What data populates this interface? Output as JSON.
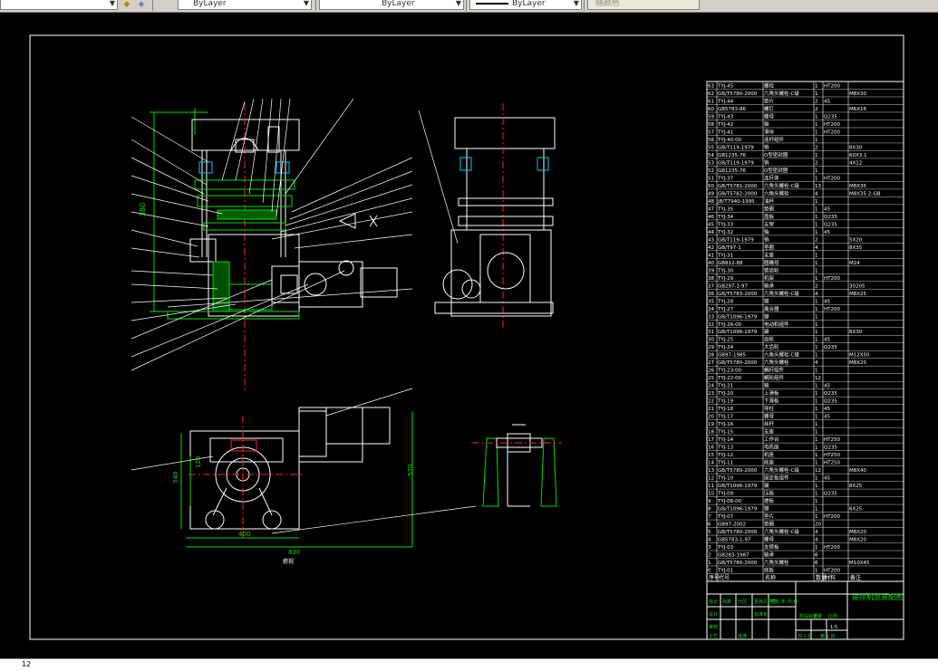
{
  "toolbar": {
    "layer_icon": "layer-stack-icon",
    "color_select": "ByLayer",
    "linetype_select": "ByLayer",
    "lineweight_select": "ByLayer",
    "plotstyle_select": "随颜色"
  },
  "drawing": {
    "title_block_name": "搓丝机总装配图",
    "bottom_label": "俯视"
  },
  "dimensions": {
    "height_left": "380",
    "width_base": "400",
    "width_total": "830",
    "plan_height": "340",
    "plan_depth": "120",
    "overall_height": "570"
  },
  "bom_header": [
    "序号",
    "代号",
    "名称",
    "数量",
    "材料",
    "备注"
  ],
  "bom_rows": [
    [
      "63",
      "TYJ-45",
      "螺栓",
      "1",
      "HT200",
      ""
    ],
    [
      "62",
      "GB/T5780-2000",
      "六角头螺栓-C级",
      "1",
      "",
      "M8X30"
    ],
    [
      "61",
      "TYJ-44",
      "垫片",
      "2",
      "45",
      ""
    ],
    [
      "60",
      "GB5783-86",
      "螺钉",
      "2",
      "",
      "M6X16"
    ],
    [
      "59",
      "TYJ-43",
      "螺母",
      "1",
      "Q235",
      ""
    ],
    [
      "58",
      "TYJ-42",
      "轴",
      "1",
      "HT200",
      ""
    ],
    [
      "57",
      "TYJ-41",
      "滑块",
      "1",
      "HT200",
      ""
    ],
    [
      "56",
      "TYJ-40-00",
      "连杆组件",
      "1",
      "",
      ""
    ],
    [
      "55",
      "GB/T119-1979",
      "销",
      "2",
      "",
      "8X30"
    ],
    [
      "54",
      "GB1235-76",
      "O型密封圈",
      "1",
      "",
      "60X3.1"
    ],
    [
      "53",
      "GB/T119-1979",
      "销",
      "2",
      "",
      "4X12"
    ],
    [
      "52",
      "GB1235-76",
      "O型密封圈",
      "1",
      "",
      ""
    ],
    [
      "51",
      "TYJ-37",
      "连杆体",
      "1",
      "HT200",
      ""
    ],
    [
      "50",
      "GB/T5781-2000",
      "六角头螺栓-C级",
      "13",
      "",
      "M8X35"
    ],
    [
      "49",
      "GB/T5782-2000",
      "六角头螺栓",
      "4",
      "",
      "M8X35 2-GB"
    ],
    [
      "48",
      "JB/T7940-1995",
      "油杯",
      "1",
      "",
      ""
    ],
    [
      "47",
      "TYJ-35",
      "垫圈",
      "1",
      "45",
      ""
    ],
    [
      "46",
      "TYJ-34",
      "盖板",
      "1",
      "Q235",
      ""
    ],
    [
      "45",
      "TYJ-33",
      "支架",
      "1",
      "Q235",
      ""
    ],
    [
      "44",
      "TYJ-32",
      "轴",
      "1",
      "45",
      ""
    ],
    [
      "43",
      "GB/T119-1979",
      "销",
      "2",
      "",
      "5X20"
    ],
    [
      "42",
      "GB/T97-1",
      "垫圈",
      "4",
      "",
      "8X35"
    ],
    [
      "41",
      "TYJ-31",
      "支座",
      "1",
      "",
      ""
    ],
    [
      "40",
      "GB812-88",
      "圆螺母",
      "1",
      "",
      "M24"
    ],
    [
      "39",
      "TYJ-30",
      "锥齿轮",
      "1",
      "",
      ""
    ],
    [
      "38",
      "TYJ-29",
      "机架",
      "1",
      "HT200",
      ""
    ],
    [
      "37",
      "GB297-1-97",
      "轴承",
      "2",
      "",
      "30205"
    ],
    [
      "36",
      "GB/T5783-2000",
      "六角头螺栓-C级",
      "4",
      "",
      "M8X25"
    ],
    [
      "35",
      "TYJ-28",
      "键",
      "1",
      "45",
      ""
    ],
    [
      "34",
      "TYJ-27",
      "离合器",
      "1",
      "HT200",
      ""
    ],
    [
      "33",
      "GB/T1096-1979",
      "键",
      "1",
      "",
      ""
    ],
    [
      "32",
      "TYJ-26-00",
      "电动机组件",
      "1",
      "",
      ""
    ],
    [
      "31",
      "GB/T1096-1979",
      "键",
      "1",
      "",
      "8X30"
    ],
    [
      "30",
      "TYJ-25",
      "齿轮",
      "1",
      "45",
      ""
    ],
    [
      "29",
      "TYJ-24",
      "大齿轮",
      "1",
      "Q235",
      ""
    ],
    [
      "28",
      "GB97-1985",
      "六角头螺栓-C级",
      "1",
      "",
      "M12X50"
    ],
    [
      "27",
      "GB/T5780-2000",
      "六角头螺栓",
      "4",
      "",
      "M8X20"
    ],
    [
      "26",
      "TYJ-23-00",
      "蜗杆组件",
      "1",
      "",
      ""
    ],
    [
      "25",
      "TYJ-22-00",
      "蜗轮组件",
      "12",
      "",
      ""
    ],
    [
      "24",
      "TYJ-21",
      "轴",
      "1",
      "45",
      ""
    ],
    [
      "23",
      "TYJ-20",
      "上滑板",
      "1",
      "Q235",
      ""
    ],
    [
      "22",
      "TYJ-19",
      "下滑板",
      "1",
      "Q235",
      ""
    ],
    [
      "21",
      "TYJ-18",
      "导柱",
      "1",
      "45",
      ""
    ],
    [
      "20",
      "TYJ-17",
      "螺母",
      "1",
      "45",
      ""
    ],
    [
      "19",
      "TYJ-16",
      "丝杆",
      "1",
      "",
      ""
    ],
    [
      "18",
      "TYJ-15",
      "支座",
      "1",
      "",
      ""
    ],
    [
      "17",
      "TYJ-14",
      "工作台",
      "1",
      "HT250",
      ""
    ],
    [
      "16",
      "TYJ-13",
      "电机座",
      "1",
      "Q235",
      ""
    ],
    [
      "15",
      "TYJ-12",
      "机座",
      "1",
      "HT250",
      ""
    ],
    [
      "14",
      "TYJ-11",
      "底座",
      "1",
      "HT250",
      ""
    ],
    [
      "13",
      "GB/T5780-2000",
      "六角头螺栓-C级",
      "12",
      "",
      "M8X40"
    ],
    [
      "12",
      "TYJ-10",
      "固定板组件",
      "1",
      "45",
      ""
    ],
    [
      "11",
      "GB/T1096-1979",
      "键",
      "1",
      "",
      "8X25"
    ],
    [
      "10",
      "TYJ-09",
      "压板",
      "1",
      "Q235",
      ""
    ],
    [
      "9",
      "TYJ-08-00",
      "搓板",
      "1",
      "",
      ""
    ],
    [
      "8",
      "GB/T1096-1979",
      "键",
      "1",
      "",
      "6X25"
    ],
    [
      "7",
      "TYJ-07",
      "垫片",
      "1",
      "HT200",
      ""
    ],
    [
      "6",
      "GB97-2002",
      "垫圈",
      "20",
      "",
      ""
    ],
    [
      "5",
      "GB/T5780-2000",
      "六角头螺栓-C级",
      "4",
      "",
      "M8X20"
    ],
    [
      "4",
      "GB5783-1-97",
      "螺母",
      "4",
      "",
      "M8X20"
    ],
    [
      "3",
      "TYJ-03",
      "支撑板",
      "1",
      "HT200",
      ""
    ],
    [
      "2",
      "GB283-1987",
      "轴承",
      "6",
      "",
      ""
    ],
    [
      "1",
      "GB/T5780-2000",
      "六角头螺栓",
      "6",
      "",
      "M10X45"
    ],
    [
      "0",
      "TYJ-01",
      "底板",
      "1",
      "HT200",
      ""
    ]
  ],
  "title_block": {
    "r1": [
      "标记",
      "处数",
      "分区",
      "更改文件号",
      "签名",
      "年.月.日"
    ],
    "r2": [
      "设计",
      "",
      "",
      "标准化",
      "",
      ""
    ],
    "stage_label": "阶段标记",
    "weight": "重量",
    "scale": "比例",
    "scale_val": "1:5",
    "sheet": "共 1 张",
    "sheet_no": "第 1 张",
    "approve": "审核",
    "process": "工艺",
    "ok": "批准"
  },
  "status": {
    "coord": "12"
  }
}
